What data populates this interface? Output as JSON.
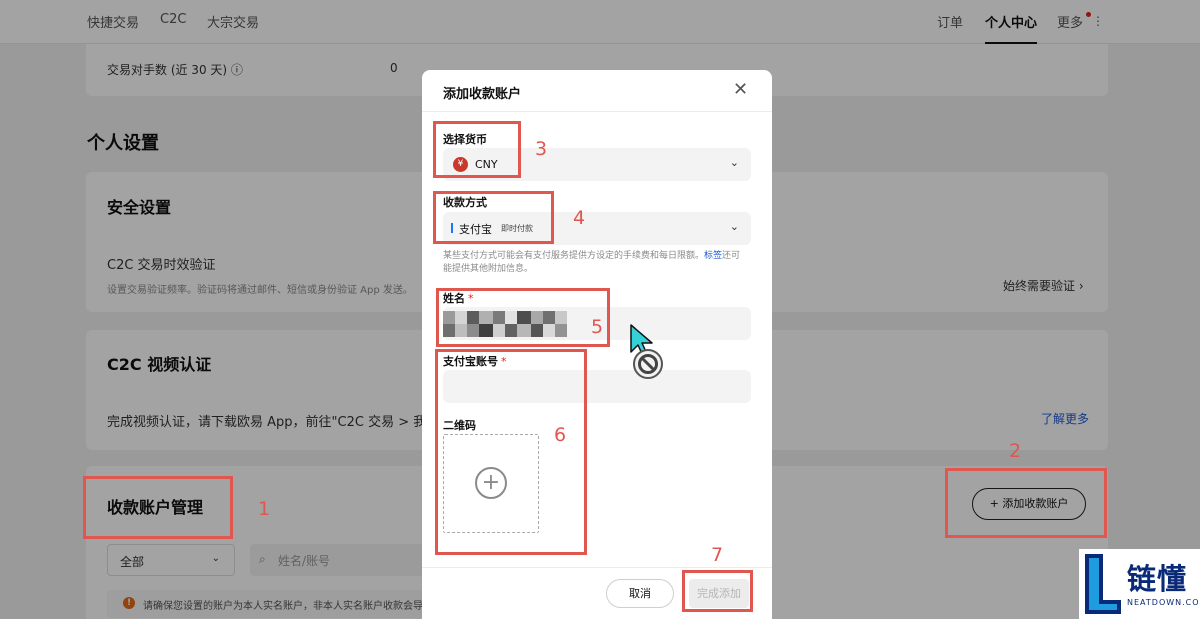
{
  "nav": {
    "left": [
      "快捷交易",
      "C2C",
      "大宗交易"
    ],
    "right": [
      "订单",
      "个人中心",
      "更多"
    ],
    "active": "个人中心"
  },
  "stats": {
    "label": "交易对手数 (近 30 天)",
    "value": "0"
  },
  "personal_settings": {
    "title": "个人设置"
  },
  "security": {
    "title": "安全设置",
    "item_title": "C2C 交易时效验证",
    "item_desc": "设置交易验证频率。验证码将通过邮件、短信或身份验证 App 发送。",
    "item_value": "始终需要验证 ›"
  },
  "video": {
    "title": "C2C 视频认证",
    "desc": "完成视频认证，请下载欧易 App，前往\"C2C 交易 > 我",
    "link": "了解更多"
  },
  "accounts": {
    "title": "收款账户管理",
    "add_button": "+ 添加收款账户",
    "filter_value": "全部",
    "search_placeholder": "姓名/账号",
    "notice": "请确保您设置的账户为本人实名账户，非本人实名账户收款会导"
  },
  "modal": {
    "title": "添加收款账户",
    "currency_label": "选择货币",
    "currency_symbol": "¥",
    "currency_value": "CNY",
    "method_label": "收款方式",
    "method_value": "支付宝",
    "method_tag": "即时付款",
    "helper_text": "某些支付方式可能会有支付服务提供方设定的手续费和每日限额。",
    "helper_link": "标签",
    "helper_text2": "还可能提供其他附加信息。",
    "name_label": "姓名",
    "account_label": "支付宝账号",
    "qr_label": "二维码",
    "required_mark": "*",
    "cancel": "取消",
    "confirm": "完成添加"
  },
  "annotations": [
    "1",
    "2",
    "3",
    "4",
    "5",
    "6",
    "7"
  ],
  "watermark": {
    "cn": "链懂",
    "en": "NEATDOWN.COM"
  },
  "colors": {
    "annotation": "#e0574f",
    "link": "#1f5bd8",
    "brand_logo": "#0a2a78"
  },
  "icons": [
    "info-icon",
    "chevron-down-icon",
    "search-icon",
    "warning-icon",
    "close-icon",
    "yuan-icon",
    "plus-circle-icon",
    "cursor-not-allowed-icon"
  ]
}
